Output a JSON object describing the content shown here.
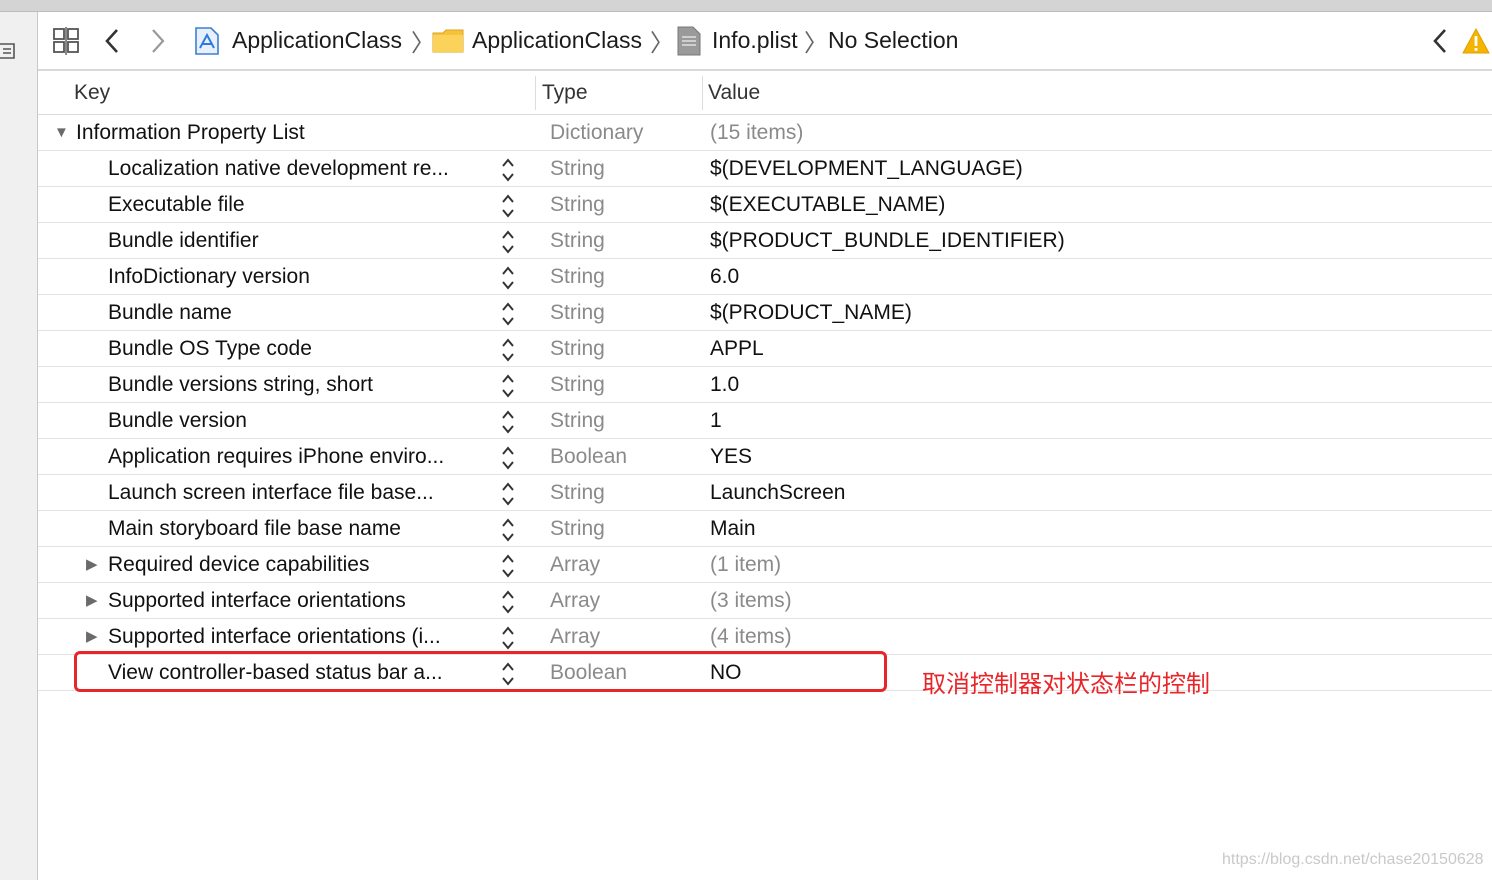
{
  "breadcrumb": {
    "project": "ApplicationClass",
    "group": "ApplicationClass",
    "file": "Info.plist",
    "selection": "No Selection"
  },
  "columns": {
    "key": "Key",
    "type": "Type",
    "value": "Value"
  },
  "root": {
    "key": "Information Property List",
    "type": "Dictionary",
    "value": "(15 items)"
  },
  "rows": [
    {
      "key": "Localization native development re...",
      "type": "String",
      "value": "$(DEVELOPMENT_LANGUAGE)"
    },
    {
      "key": "Executable file",
      "type": "String",
      "value": "$(EXECUTABLE_NAME)"
    },
    {
      "key": "Bundle identifier",
      "type": "String",
      "value": "$(PRODUCT_BUNDLE_IDENTIFIER)"
    },
    {
      "key": "InfoDictionary version",
      "type": "String",
      "value": "6.0"
    },
    {
      "key": "Bundle name",
      "type": "String",
      "value": "$(PRODUCT_NAME)"
    },
    {
      "key": "Bundle OS Type code",
      "type": "String",
      "value": "APPL"
    },
    {
      "key": "Bundle versions string, short",
      "type": "String",
      "value": "1.0"
    },
    {
      "key": "Bundle version",
      "type": "String",
      "value": "1"
    },
    {
      "key": "Application requires iPhone enviro...",
      "type": "Boolean",
      "value": "YES"
    },
    {
      "key": "Launch screen interface file base...",
      "type": "String",
      "value": "LaunchScreen"
    },
    {
      "key": "Main storyboard file base name",
      "type": "String",
      "value": "Main"
    },
    {
      "key": "Required device capabilities",
      "type": "Array",
      "value": "(1 item)"
    },
    {
      "key": "Supported interface orientations",
      "type": "Array",
      "value": "(3 items)"
    },
    {
      "key": "Supported interface orientations (i...",
      "type": "Array",
      "value": "(4 items)"
    },
    {
      "key": "View controller-based status bar a...",
      "type": "Boolean",
      "value": "NO"
    }
  ],
  "annotation": "取消控制器对状态栏的控制",
  "watermark": "https://blog.csdn.net/chase20150628",
  "colors": {
    "annotation": "#e8262a",
    "warning": "#f5b400"
  }
}
